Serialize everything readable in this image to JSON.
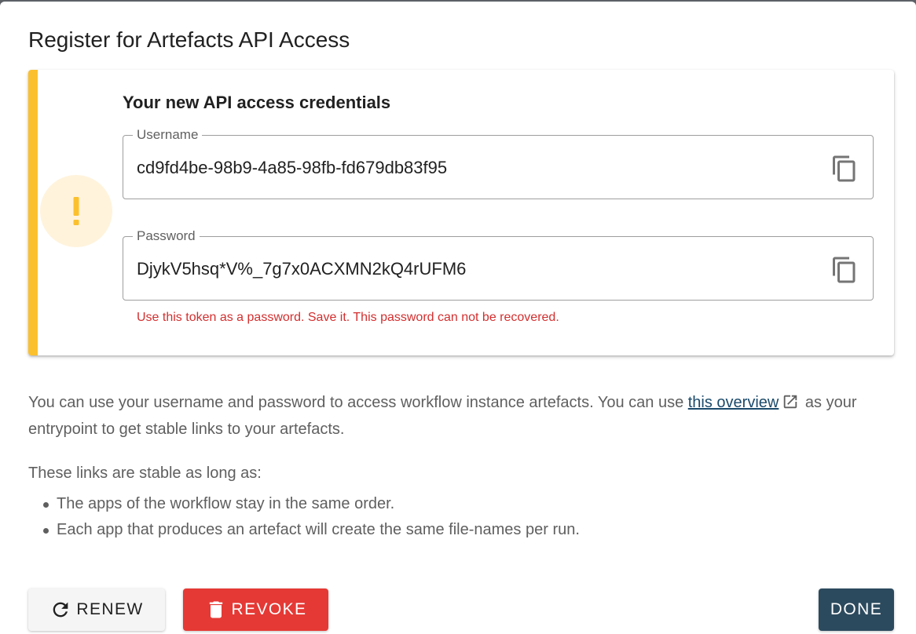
{
  "dialog": {
    "title": "Register for Artefacts API Access"
  },
  "alert": {
    "accent_color": "#fbc02d",
    "icon": "exclamation-icon",
    "heading": "Your new API access credentials",
    "username": {
      "label": "Username",
      "value": "cd9fd4be-98b9-4a85-98fb-fd679db83f95",
      "copy_icon": "copy-icon"
    },
    "password": {
      "label": "Password",
      "value": "DjykV5hsq*V%_7g7x0ACXMN2kQ4rUFM6",
      "copy_icon": "copy-icon",
      "hint": "Use this token as a password. Save it. This password can not be recovered."
    }
  },
  "body": {
    "paragraph1_before": "You can use your username and password to access workflow instance artefacts. You can use ",
    "paragraph1_link": "this overview",
    "paragraph1_after": " as your entrypoint to get stable links to your artefacts.",
    "paragraph2": "These links are stable as long as:",
    "bullets": [
      "The apps of the workflow stay in the same order.",
      "Each app that produces an artefact will create the same file-names per run."
    ]
  },
  "actions": {
    "renew": "RENEW",
    "revoke": "REVOKE",
    "done": "DONE",
    "revoke_color": "#e53935",
    "done_color": "#2c4a5e"
  }
}
